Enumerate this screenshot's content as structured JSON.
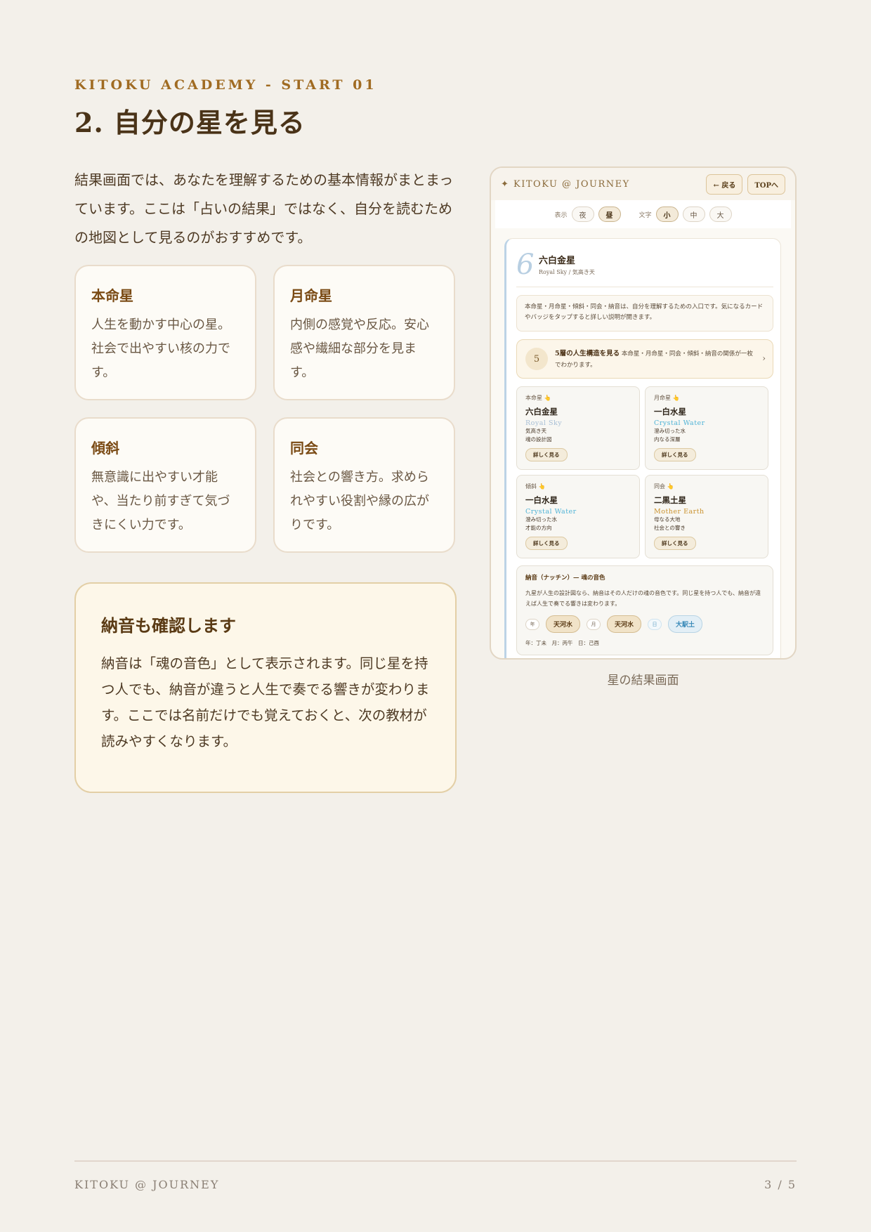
{
  "header": {
    "eyebrow": "KITOKU ACADEMY - START 01",
    "title": "2. 自分の星を見る"
  },
  "intro": "結果画面では、あなたを理解するための基本情報がまとまっています。ここは「占いの結果」ではなく、自分を読むための地図として見るのがおすすめです。",
  "cards": [
    {
      "title": "本命星",
      "body": "人生を動かす中心の星。社会で出やすい核の力です。"
    },
    {
      "title": "月命星",
      "body": "内側の感覚や反応。安心感や繊細な部分を見ます。"
    },
    {
      "title": "傾斜",
      "body": "無意識に出やすい才能や、当たり前すぎて気づきにくい力です。"
    },
    {
      "title": "同会",
      "body": "社会との響き方。求められやすい役割や縁の広がりです。"
    }
  ],
  "note": {
    "title": "納音も確認します",
    "body": "納音は「魂の音色」として表示されます。同じ星を持つ人でも、納音が違うと人生で奏でる響きが変わります。ここでは名前だけでも覚えておくと、次の教材が読みやすくなります。"
  },
  "screenshot": {
    "brand": "✦ KITOKU @ JOURNEY",
    "back_button": "← 戻る",
    "top_button": "TOPへ",
    "toolbar": {
      "display_label": "表示",
      "night": "夜",
      "day": "昼",
      "text_label": "文字",
      "small": "小",
      "medium": "中",
      "large": "大"
    },
    "number": "6",
    "star_name": "六白金星",
    "star_sub": "Royal Sky / 気高き天",
    "info": "本命星・月命星・傾斜・同会・納音は、自分を理解するための入口です。気になるカードやバッジをタップすると詳しい説明が開きます。",
    "structure": {
      "number": "5",
      "title": "5層の人生構造を見る",
      "desc": "本命星・月命星・同会・傾斜・納音の関係が一枚でわかります。",
      "chevron": "›"
    },
    "stars": [
      {
        "label": "本命星 👆",
        "name": "六白金星",
        "en": "Royal Sky",
        "line1": "気高き天",
        "line2": "魂の設計図",
        "button": "詳しく見る"
      },
      {
        "label": "月命星 👆",
        "name": "一白水星",
        "en": "Crystal Water",
        "line1": "澄み切った水",
        "line2": "内なる深層",
        "button": "詳しく見る"
      },
      {
        "label": "傾斜 👆",
        "name": "一白水星",
        "en": "Crystal Water",
        "line1": "澄み切った水",
        "line2": "才能の方向",
        "button": "詳しく見る"
      },
      {
        "label": "同会 👆",
        "name": "二黒土星",
        "en": "Mother Earth",
        "line1": "母なる大地",
        "line2": "社会との響き",
        "button": "詳しく見る"
      }
    ],
    "nacchin": {
      "title": "納音（ナッチン）— 魂の音色",
      "text": "九星が人生の設計図なら、納音はその人だけの魂の音色です。同じ星を持つ人でも、納音が違えば人生で奏でる響きは変わります。",
      "chips": [
        {
          "tag": "年",
          "name": "天河水"
        },
        {
          "tag": "月",
          "name": "天河水"
        },
        {
          "tag": "日",
          "name": "大駅土"
        }
      ],
      "footer": "年：丁未　月：丙午　日：己酉"
    },
    "colors": {
      "royal_sky": "#a8bfd6",
      "crystal_water": "#4fb3d6",
      "mother_earth": "#c9902a"
    }
  },
  "caption": "星の結果画面",
  "footer": {
    "brand": "KITOKU @ JOURNEY",
    "page": "3 / 5"
  }
}
